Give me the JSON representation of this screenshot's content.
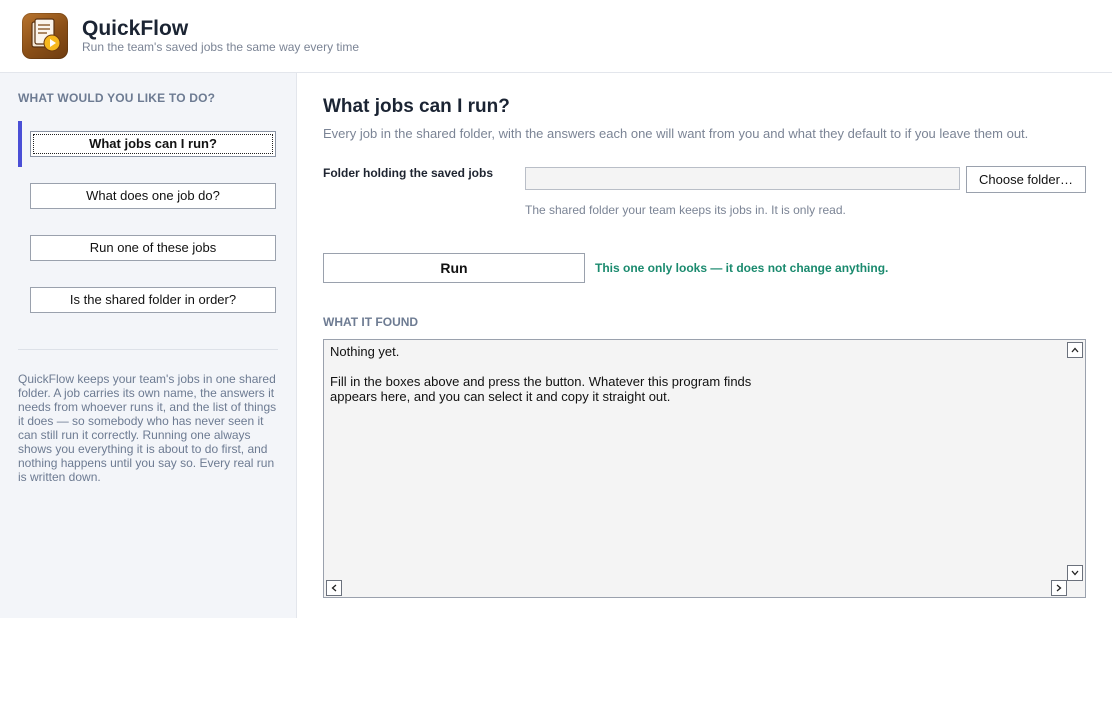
{
  "app": {
    "title": "QuickFlow",
    "subtitle": "Run the team's saved jobs the same way every time",
    "icon": "job-runner-app-icon"
  },
  "sidebar": {
    "heading": "WHAT WOULD YOU LIKE TO DO?",
    "items": [
      {
        "label": "What jobs can I run?",
        "active": true
      },
      {
        "label": "What does one job do?",
        "active": false
      },
      {
        "label": "Run one of these jobs",
        "active": false
      },
      {
        "label": "Is the shared folder in order?",
        "active": false
      }
    ],
    "about": "QuickFlow keeps your team's jobs in one shared folder. A job carries its own name, the answers it needs from whoever runs it, and the list of things it does — so somebody who has never seen it can still run it correctly. Running one always shows you everything it is about to do first, and nothing happens until you say so. Every real run is written down."
  },
  "main": {
    "title": "What jobs can I run?",
    "description": "Every job in the shared folder, with the answers each one will want from you and what they default to if you leave them out.",
    "folder_field": {
      "label": "Folder holding the saved jobs",
      "value": "",
      "choose_label": "Choose folder…",
      "help": "The shared folder your team keeps its jobs in. It is only read."
    },
    "run_label": "Run",
    "safe_note": "This one only looks — it does not change anything.",
    "output": {
      "label": "WHAT IT FOUND",
      "text": "Nothing yet.\n\nFill in the boxes above and press the button. Whatever this program finds\nappears here, and you can select it and copy it straight out."
    }
  },
  "colors": {
    "accent": "#4a4fd6",
    "safe_note": "#1a8a6e",
    "muted_text": "#7b8495",
    "sidebar_bg": "#f3f5f9"
  }
}
